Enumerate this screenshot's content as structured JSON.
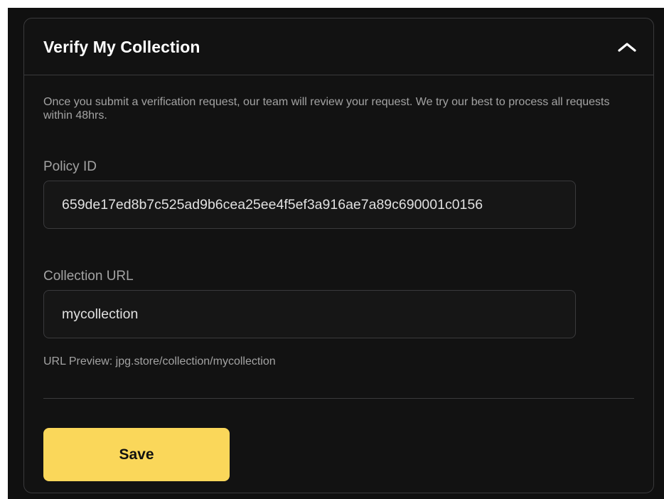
{
  "card": {
    "title": "Verify My Collection",
    "collapse_icon": "chevron-up-icon"
  },
  "description": "Once you submit a verification request, our team will review your request. We try our best to process all requests within 48hrs.",
  "policy": {
    "label": "Policy ID",
    "value": "659de17ed8b7c525ad9b6cea25ee4f5ef3a916ae7a89c690001c0156"
  },
  "collection_url": {
    "label": "Collection URL",
    "value": "mycollection"
  },
  "url_preview": "URL Preview: jpg.store/collection/mycollection",
  "actions": {
    "save_label": "Save"
  },
  "colors": {
    "accent": "#fad75a",
    "background": "#121212",
    "border": "#3a3a3c"
  }
}
